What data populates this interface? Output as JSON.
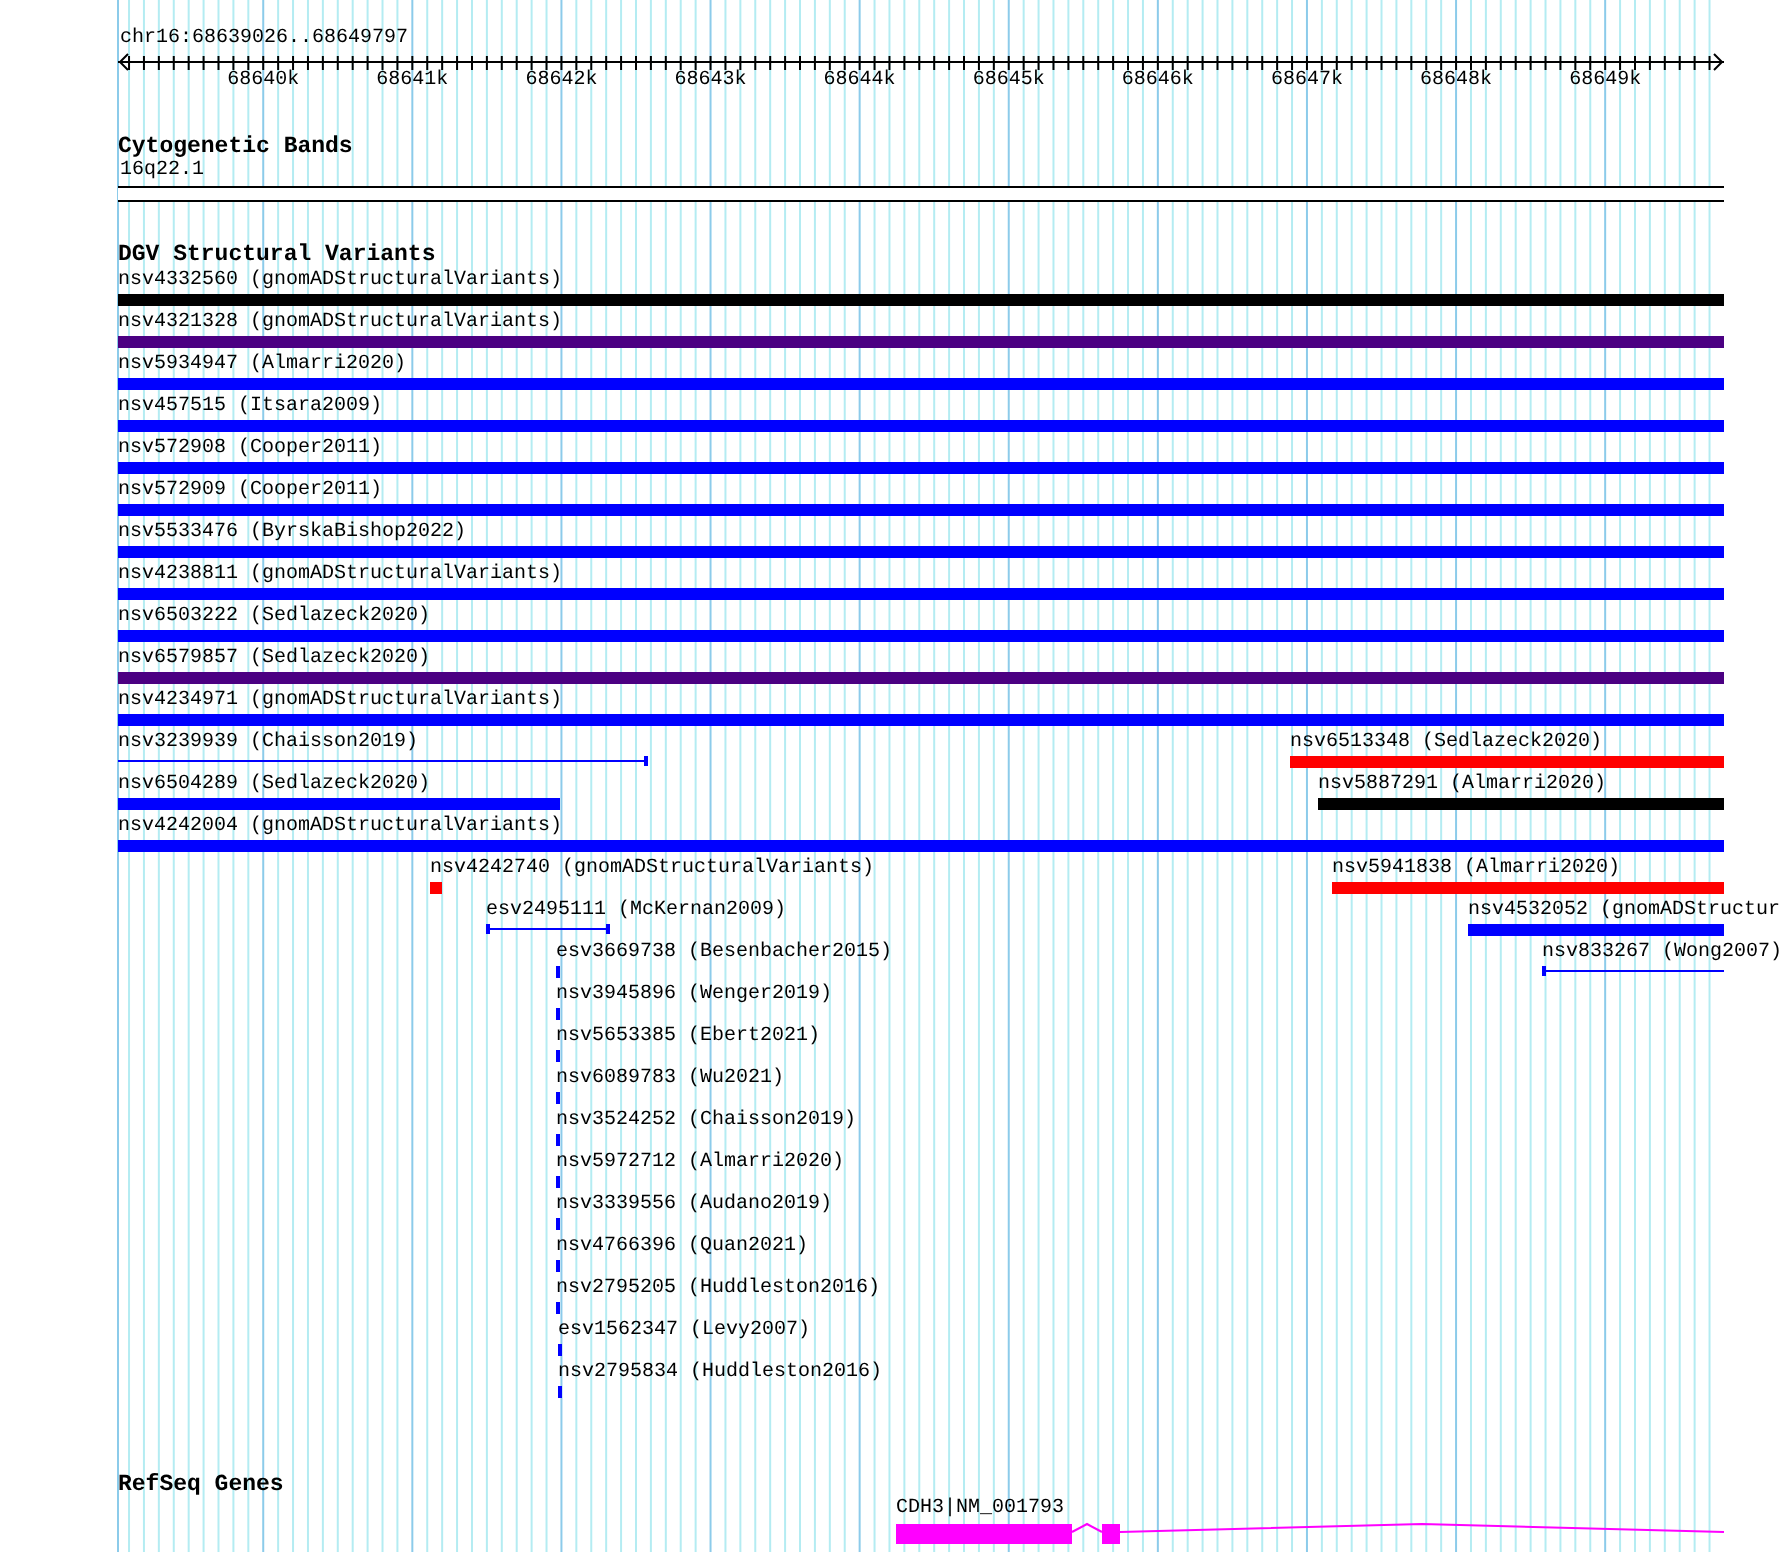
{
  "location": "chr16:68639026..68649797",
  "ruler": {
    "labels": [
      "68640k",
      "68641k",
      "68642k",
      "68643k",
      "68644k",
      "68645k",
      "68646k",
      "68647k",
      "68648k",
      "68649k"
    ]
  },
  "tracks": [
    {
      "kind": "cytoband",
      "title": "Cytogenetic Bands",
      "band": {
        "name": "16q22.1"
      }
    },
    {
      "kind": "variants",
      "title": "DGV Structural Variants",
      "rows": [
        [
          {
            "label": "nsv4332560 (gnomADStructuralVariants)",
            "kind": "bar",
            "color": "#000000"
          }
        ],
        [
          {
            "label": "nsv4321328 (gnomADStructuralVariants)",
            "kind": "bar",
            "color": "#4b0082"
          }
        ],
        [
          {
            "label": "nsv5934947 (Almarri2020)",
            "kind": "bar",
            "color": "#0000ff"
          }
        ],
        [
          {
            "label": "nsv457515 (Itsara2009)",
            "kind": "bar",
            "color": "#0000ff"
          }
        ],
        [
          {
            "label": "nsv572908 (Cooper2011)",
            "kind": "bar",
            "color": "#0000ff"
          }
        ],
        [
          {
            "label": "nsv572909 (Cooper2011)",
            "kind": "bar",
            "color": "#0000ff"
          }
        ],
        [
          {
            "label": "nsv5533476 (ByrskaBishop2022)",
            "kind": "bar",
            "color": "#0000ff"
          }
        ],
        [
          {
            "label": "nsv4238811 (gnomADStructuralVariants)",
            "kind": "bar",
            "color": "#0000ff"
          }
        ],
        [
          {
            "label": "nsv6503222 (Sedlazeck2020)",
            "kind": "bar",
            "color": "#0000ff"
          }
        ],
        [
          {
            "label": "nsv6579857 (Sedlazeck2020)",
            "kind": "bar",
            "color": "#4b0082"
          }
        ],
        [
          {
            "label": "nsv4234971 (gnomADStructuralVariants)",
            "kind": "bar",
            "color": "#0000ff"
          }
        ],
        [
          {
            "label": "nsv3239939 (Chaisson2019)",
            "kind": "line",
            "color": "#0000ff"
          },
          {
            "label": "nsv6513348 (Sedlazeck2020)",
            "kind": "bar",
            "color": "#ff0000"
          }
        ],
        [
          {
            "label": "nsv6504289 (Sedlazeck2020)",
            "kind": "bar",
            "color": "#0000ff"
          },
          {
            "label": "nsv5887291 (Almarri2020)",
            "kind": "bar",
            "color": "#000000"
          }
        ],
        [
          {
            "label": "nsv4242004 (gnomADStructuralVariants)",
            "kind": "bar",
            "color": "#0000ff"
          }
        ],
        [
          {
            "label": "nsv4242740 (gnomADStructuralVariants)",
            "kind": "bar",
            "color": "#ff0000"
          },
          {
            "label": "nsv5941838 (Almarri2020)",
            "kind": "bar",
            "color": "#ff0000"
          }
        ],
        [
          {
            "label": "esv2495111 (McKernan2009)",
            "kind": "line",
            "color": "#0000ff"
          },
          {
            "label": "nsv4532052 (gnomADStructur",
            "kind": "bar",
            "color": "#0000ff"
          }
        ],
        [
          {
            "label": "esv3669738 (Besenbacher2015)",
            "kind": "bar",
            "color": "#0000ff"
          },
          {
            "label": "nsv833267 (Wong2007)",
            "kind": "line",
            "color": "#0000ff"
          }
        ],
        [
          {
            "label": "nsv3945896 (Wenger2019)",
            "kind": "bar",
            "color": "#0000ff"
          }
        ],
        [
          {
            "label": "nsv5653385 (Ebert2021)",
            "kind": "bar",
            "color": "#0000ff"
          }
        ],
        [
          {
            "label": "nsv6089783 (Wu2021)",
            "kind": "bar",
            "color": "#0000ff"
          }
        ],
        [
          {
            "label": "nsv3524252 (Chaisson2019)",
            "kind": "bar",
            "color": "#0000ff"
          }
        ],
        [
          {
            "label": "nsv5972712 (Almarri2020)",
            "kind": "bar",
            "color": "#0000ff"
          }
        ],
        [
          {
            "label": "nsv3339556 (Audano2019)",
            "kind": "bar",
            "color": "#0000ff"
          }
        ],
        [
          {
            "label": "nsv4766396 (Quan2021)",
            "kind": "bar",
            "color": "#0000ff"
          }
        ],
        [
          {
            "label": "nsv2795205 (Huddleston2016)",
            "kind": "bar",
            "color": "#0000ff"
          }
        ],
        [
          {
            "label": "esv1562347 (Levy2007)",
            "kind": "bar",
            "color": "#0000ff"
          }
        ],
        [
          {
            "label": "nsv2795834 (Huddleston2016)",
            "kind": "bar",
            "color": "#0000ff"
          }
        ]
      ]
    },
    {
      "kind": "genes",
      "title": "RefSeq Genes",
      "genes": [
        {
          "label": "CDH3|NM_001793"
        }
      ]
    }
  ]
}
